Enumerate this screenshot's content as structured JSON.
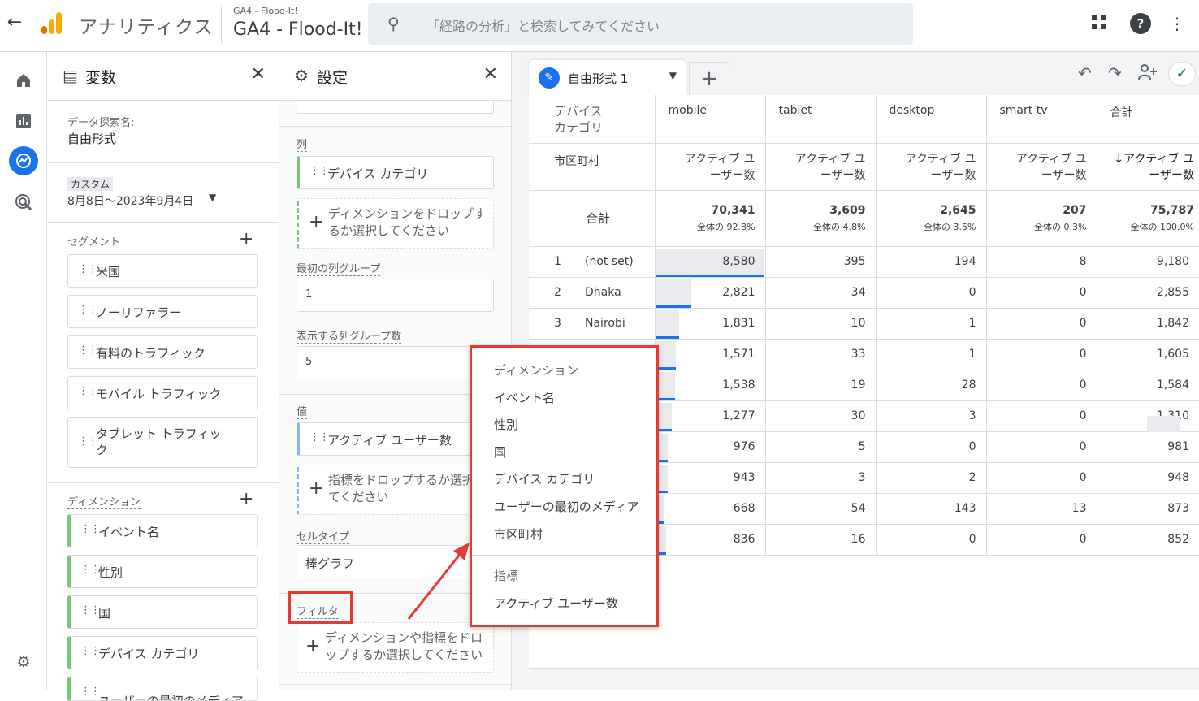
{
  "header": {
    "back_icon": "arrow-left-icon",
    "app_title": "アナリティクス",
    "property_small": "GA4 - Flood-It!",
    "property_big": "GA4 - Flood-It!",
    "search_placeholder": "「経路の分析」と検索してみてください"
  },
  "variables_panel": {
    "title": "変数",
    "exploration_name_label": "データ探索名:",
    "exploration_name": "自由形式",
    "date_badge": "カスタム",
    "date_range": "8月8日～2023年9月4日",
    "segments_label": "セグメント",
    "segments": [
      "米国",
      "ノーリファラー",
      "有料のトラフィック",
      "モバイル トラフィック",
      "タブレット トラフィック"
    ],
    "dimensions_label": "ディメンション",
    "dimensions": [
      "イベント名",
      "性別",
      "国",
      "デバイス カテゴリ",
      "ユーザーの最初のメディア"
    ]
  },
  "settings_panel": {
    "title": "設定",
    "columns_label": "列",
    "column_chip": "デバイス カテゴリ",
    "column_drop": "ディメンションをドロップするか選択してください",
    "first_col_group_label": "最初の列グループ",
    "first_col_group_value": "1",
    "col_groups_label": "表示する列グループ数",
    "col_groups_value": "5",
    "values_label": "値",
    "value_chip": "アクティブ ユーザー数",
    "value_drop": "指標をドロップするか選択してください",
    "cell_type_label": "セルタイプ",
    "cell_type_value": "棒グラフ",
    "filter_label": "フィルタ",
    "filter_drop": "ディメンションや指標をドロップするか選択してください"
  },
  "tab": {
    "label": "自由形式 1"
  },
  "table": {
    "col_dim_header": "デバイス カテゴリ",
    "row_dim_header": "市区町村",
    "columns": [
      "mobile",
      "tablet",
      "desktop",
      "smart tv",
      "合計"
    ],
    "metric_headers": [
      "アクティブ ユーザー数",
      "アクティブ ユーザー数",
      "アクティブ ユーザー数",
      "アクティブ ユーザー数",
      "↓アクティブ ユーザー数"
    ],
    "total_label": "合計",
    "totals": [
      "70,341",
      "3,609",
      "2,645",
      "207",
      "75,787"
    ],
    "totals_pct": [
      "全体の 92.8%",
      "全体の 4.8%",
      "全体の 3.5%",
      "全体の 0.3%",
      "全体の 100.0%"
    ],
    "rows": [
      {
        "idx": "1",
        "city": "(not set)",
        "vals": [
          "8,580",
          "395",
          "194",
          "8",
          "9,180"
        ]
      },
      {
        "idx": "2",
        "city": "Dhaka",
        "vals": [
          "2,821",
          "34",
          "0",
          "0",
          "2,855"
        ]
      },
      {
        "idx": "3",
        "city": "Nairobi",
        "vals": [
          "1,831",
          "10",
          "1",
          "0",
          "1,842"
        ]
      },
      {
        "idx": "",
        "city": "",
        "vals": [
          "1,571",
          "33",
          "1",
          "0",
          "1,605"
        ]
      },
      {
        "idx": "",
        "city": "",
        "vals": [
          "1,538",
          "19",
          "28",
          "0",
          "1,584"
        ]
      },
      {
        "idx": "",
        "city": "",
        "vals": [
          "1,277",
          "30",
          "3",
          "0",
          "1,310"
        ]
      },
      {
        "idx": "",
        "city": "",
        "vals": [
          "976",
          "5",
          "0",
          "0",
          "981"
        ]
      },
      {
        "idx": "",
        "city": "",
        "vals": [
          "943",
          "3",
          "2",
          "0",
          "948"
        ]
      },
      {
        "idx": "",
        "city": "",
        "vals": [
          "668",
          "54",
          "143",
          "13",
          "873"
        ]
      },
      {
        "idx": "",
        "city": "",
        "vals": [
          "836",
          "16",
          "0",
          "0",
          "852"
        ]
      }
    ],
    "mobile_fraction": [
      1.0,
      0.329,
      0.213,
      0.183,
      0.179,
      0.149,
      0.114,
      0.11,
      0.078,
      0.097
    ]
  },
  "popup": {
    "dim_header": "ディメンション",
    "dim_items": [
      "イベント名",
      "性別",
      "国",
      "デバイス カテゴリ",
      "ユーザーの最初のメディア",
      "市区町村"
    ],
    "metric_header": "指標",
    "metric_items": [
      "アクティブ ユーザー数"
    ]
  },
  "colors": {
    "accent": "#1a73e8",
    "annotation": "#e53935"
  }
}
